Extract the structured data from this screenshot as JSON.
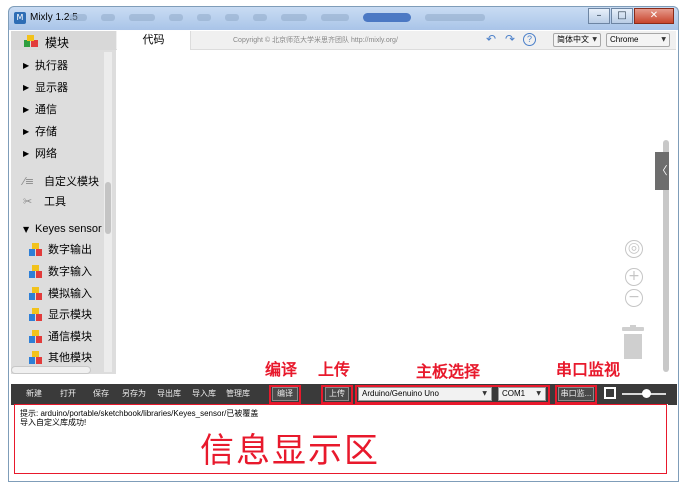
{
  "window": {
    "title": "Mixly 1.2.5",
    "controls": {
      "minimize": "–",
      "maximize": "□",
      "close": "✕"
    }
  },
  "sidebar": {
    "header": "模块",
    "categories": [
      {
        "label": "执行器",
        "icon": "triangle-right-icon"
      },
      {
        "label": "显示器",
        "icon": "triangle-right-icon"
      },
      {
        "label": "通信",
        "icon": "triangle-right-icon"
      },
      {
        "label": "存储",
        "icon": "triangle-right-icon"
      },
      {
        "label": "网络",
        "icon": "triangle-right-icon"
      },
      {
        "label": "自定义模块",
        "icon": "custom-module-icon"
      },
      {
        "label": "工具",
        "icon": "tools-icon"
      },
      {
        "label": "Keyes sensor",
        "icon": "triangle-down-icon"
      }
    ],
    "blocks": [
      {
        "label": "数字输出"
      },
      {
        "label": "数字输入"
      },
      {
        "label": "模拟输入"
      },
      {
        "label": "显示模块"
      },
      {
        "label": "通信模块"
      },
      {
        "label": "其他模块"
      }
    ]
  },
  "topbar": {
    "code_tab": "代码",
    "copyright": "Copyright © 北京师范大学米思齐团队 http://mixly.org/",
    "undo": "↶",
    "redo": "↷",
    "help": "?",
    "language": "简体中文",
    "browser": "Chrome",
    "side_tab": "〈"
  },
  "workspace": {
    "zoom_reset": "◎",
    "zoom_in": "+",
    "zoom_out": "−"
  },
  "annotations": {
    "compile": "编译",
    "upload": "上传",
    "board_select": "主板选择",
    "serial_monitor": "串口监视",
    "info_area": "信息显示区"
  },
  "toolbar": {
    "new": "新建",
    "open": "打开",
    "save": "保存",
    "save_as": "另存为",
    "export_lib": "导出库",
    "import_lib": "导入库",
    "manage_lib": "管理库",
    "compile": "编译",
    "upload": "上传",
    "board": "Arduino/Genuino Uno",
    "port": "COM1",
    "serial": "串口监..."
  },
  "messages": [
    "提示: arduino/portable/sketchbook/libraries/Keyes_sensor/已被覆盖",
    "导入自定义库成功!"
  ],
  "colors": {
    "annotation": "#e8192c",
    "toolbar": "#3a3a3a",
    "sidebar": "#dddddd",
    "accent": "#4a7fc9"
  }
}
